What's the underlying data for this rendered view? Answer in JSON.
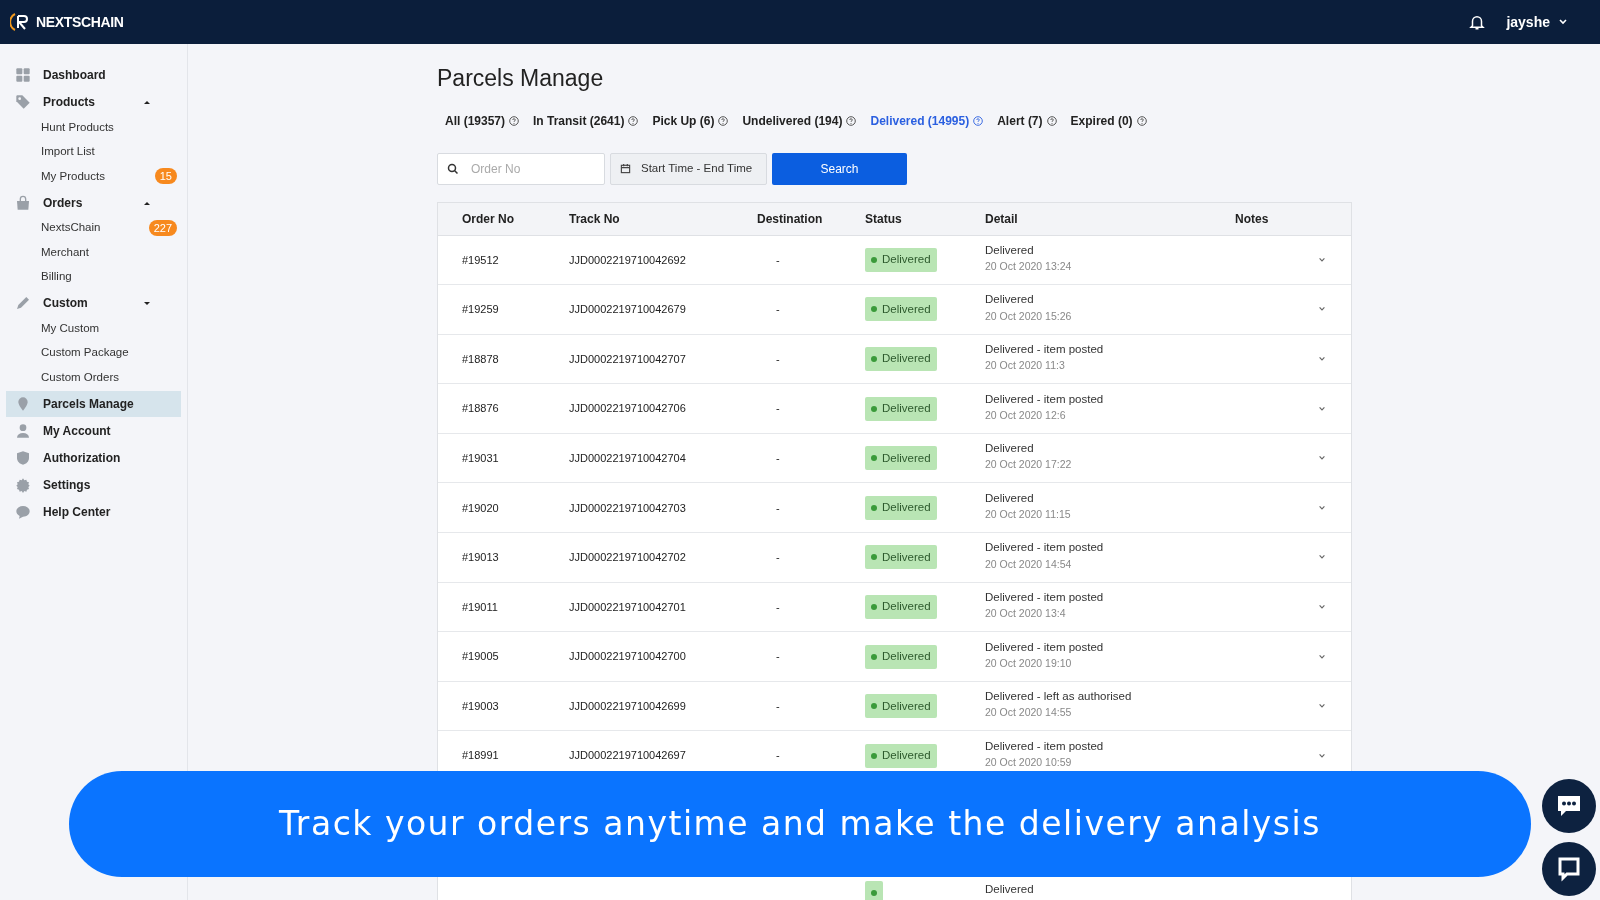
{
  "brand": "NEXTSCHAIN",
  "user": {
    "name": "jayshe"
  },
  "sidebar": {
    "items": [
      {
        "label": "Dashboard",
        "selected": false
      },
      {
        "label": "Products",
        "selected": false,
        "expanded": true,
        "children": [
          {
            "label": "Hunt Products"
          },
          {
            "label": "Import List"
          },
          {
            "label": "My Products",
            "badge": "15"
          }
        ]
      },
      {
        "label": "Orders",
        "selected": false,
        "expanded": true,
        "children": [
          {
            "label": "NextsChain",
            "badge": "227"
          },
          {
            "label": "Merchant"
          },
          {
            "label": "Billing"
          }
        ]
      },
      {
        "label": "Custom",
        "selected": false,
        "expanded": false,
        "children": [
          {
            "label": "My Custom"
          },
          {
            "label": "Custom Package"
          },
          {
            "label": "Custom Orders"
          }
        ]
      },
      {
        "label": "Parcels Manage",
        "selected": true
      },
      {
        "label": "My Account",
        "selected": false
      },
      {
        "label": "Authorization",
        "selected": false
      },
      {
        "label": "Settings",
        "selected": false
      },
      {
        "label": "Help Center",
        "selected": false
      }
    ]
  },
  "page_title": "Parcels Manage",
  "tabs": [
    {
      "label": "All (19357)",
      "selected": false
    },
    {
      "label": "In Transit (2641)",
      "selected": false
    },
    {
      "label": "Pick Up (6)",
      "selected": false
    },
    {
      "label": "Undelivered (194)",
      "selected": false
    },
    {
      "label": "Delivered (14995)",
      "selected": true
    },
    {
      "label": "Alert (7)",
      "selected": false
    },
    {
      "label": "Expired (0)",
      "selected": false
    }
  ],
  "search": {
    "placeholder": "Order No",
    "date_range": "Start Time - End Time",
    "button": "Search"
  },
  "table": {
    "columns": [
      "Order No",
      "Track No",
      "Destination",
      "Status",
      "Detail",
      "Notes"
    ],
    "rows": [
      {
        "order_no": "#19512",
        "track_no": "JJD0002219710042692",
        "destination": "-",
        "status": "Delivered",
        "detail": "Delivered",
        "time": "20 Oct 2020 13:24"
      },
      {
        "order_no": "#19259",
        "track_no": "JJD0002219710042679",
        "destination": "-",
        "status": "Delivered",
        "detail": "Delivered",
        "time": "20 Oct 2020 15:26"
      },
      {
        "order_no": "#18878",
        "track_no": "JJD0002219710042707",
        "destination": "-",
        "status": "Delivered",
        "detail": "Delivered - item posted",
        "time": "20 Oct 2020 11:3"
      },
      {
        "order_no": "#18876",
        "track_no": "JJD0002219710042706",
        "destination": "-",
        "status": "Delivered",
        "detail": "Delivered - item posted",
        "time": "20 Oct 2020 12:6"
      },
      {
        "order_no": "#19031",
        "track_no": "JJD0002219710042704",
        "destination": "-",
        "status": "Delivered",
        "detail": "Delivered",
        "time": "20 Oct 2020 17:22"
      },
      {
        "order_no": "#19020",
        "track_no": "JJD0002219710042703",
        "destination": "-",
        "status": "Delivered",
        "detail": "Delivered",
        "time": "20 Oct 2020 11:15"
      },
      {
        "order_no": "#19013",
        "track_no": "JJD0002219710042702",
        "destination": "-",
        "status": "Delivered",
        "detail": "Delivered - item posted",
        "time": "20 Oct 2020 14:54"
      },
      {
        "order_no": "#19011",
        "track_no": "JJD0002219710042701",
        "destination": "-",
        "status": "Delivered",
        "detail": "Delivered - item posted",
        "time": "20 Oct 2020 13:4"
      },
      {
        "order_no": "#19005",
        "track_no": "JJD0002219710042700",
        "destination": "-",
        "status": "Delivered",
        "detail": "Delivered - item posted",
        "time": "20 Oct 2020 19:10"
      },
      {
        "order_no": "#19003",
        "track_no": "JJD0002219710042699",
        "destination": "-",
        "status": "Delivered",
        "detail": "Delivered - left as authorised",
        "time": "20 Oct 2020 14:55"
      },
      {
        "order_no": "#18991",
        "track_no": "JJD0002219710042697",
        "destination": "-",
        "status": "Delivered",
        "detail": "Delivered - item posted",
        "time": "20 Oct 2020 10:59"
      }
    ],
    "partial_row": {
      "detail": "Delivered"
    }
  },
  "banner": "Track your orders anytime and make the delivery analysis"
}
